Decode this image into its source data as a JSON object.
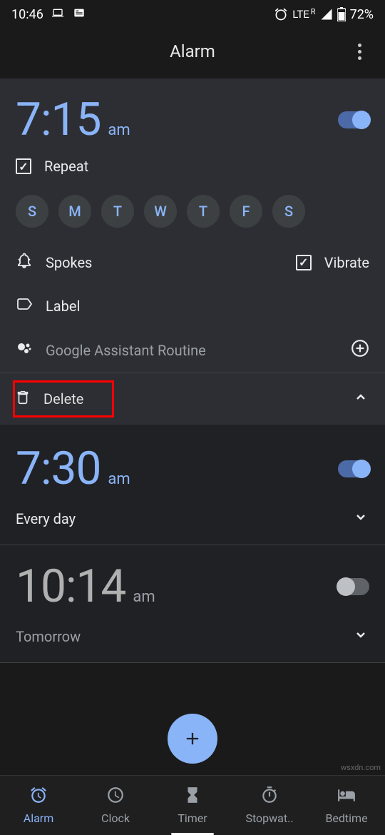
{
  "status": {
    "time": "10:46",
    "network": "LTE",
    "roaming": "R",
    "battery": "72%"
  },
  "header": {
    "title": "Alarm"
  },
  "alarms": [
    {
      "time": "7:15",
      "ampm": "am",
      "enabled": true,
      "expanded": true,
      "repeat_label": "Repeat",
      "repeat_checked": true,
      "days": [
        "S",
        "M",
        "T",
        "W",
        "T",
        "F",
        "S"
      ],
      "sound_label": "Spokes",
      "vibrate_label": "Vibrate",
      "vibrate_checked": true,
      "label_label": "Label",
      "assistant_label": "Google Assistant Routine",
      "delete_label": "Delete"
    },
    {
      "time": "7:30",
      "ampm": "am",
      "enabled": true,
      "expanded": false,
      "summary": "Every day"
    },
    {
      "time": "10:14",
      "ampm": "am",
      "enabled": false,
      "expanded": false,
      "summary": "Tomorrow"
    }
  ],
  "nav": {
    "items": [
      {
        "label": "Alarm",
        "active": true
      },
      {
        "label": "Clock",
        "active": false
      },
      {
        "label": "Timer",
        "active": false
      },
      {
        "label": "Stopwat..",
        "active": false
      },
      {
        "label": "Bedtime",
        "active": false
      }
    ]
  },
  "watermark": "wsxdn.com"
}
